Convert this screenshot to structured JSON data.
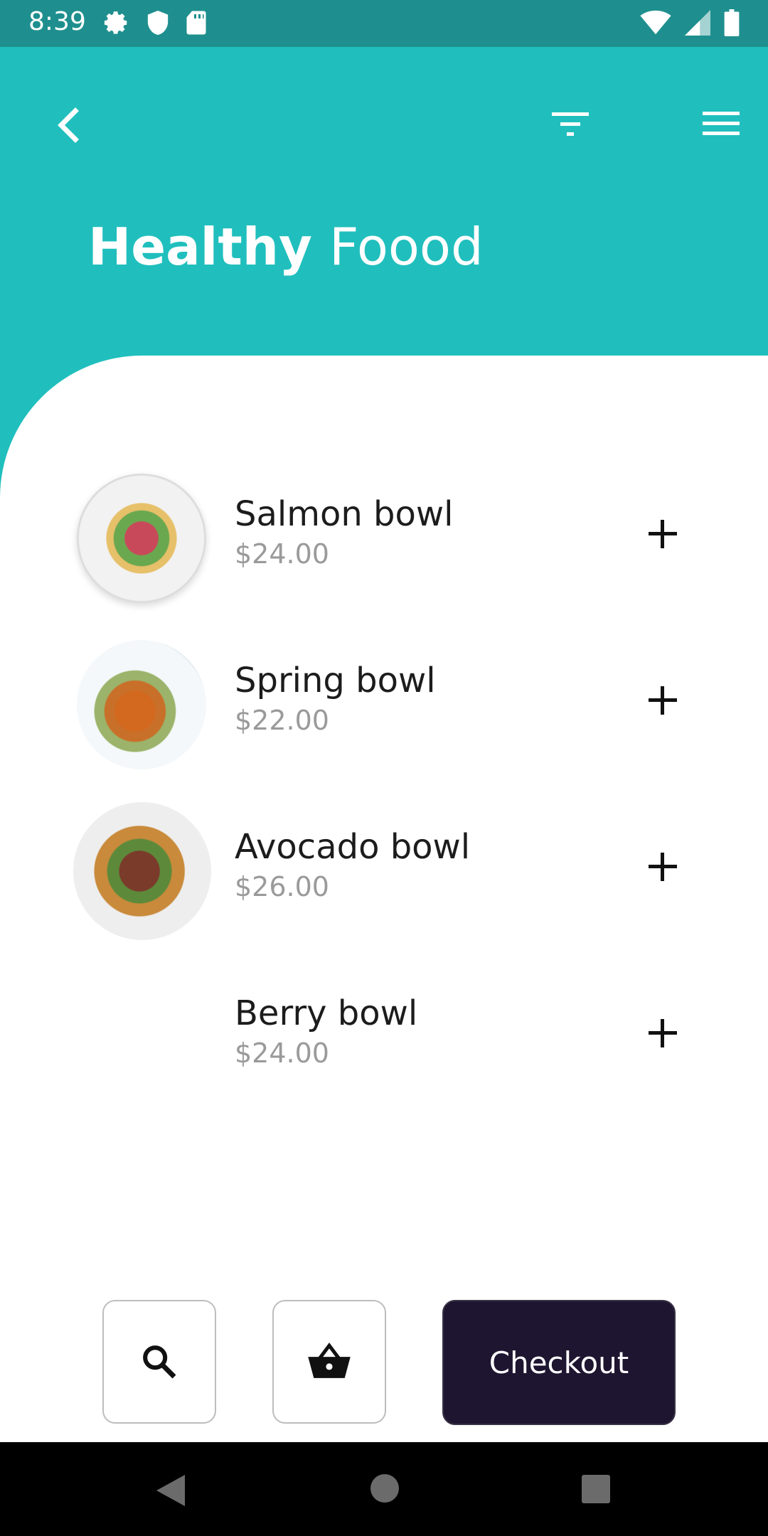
{
  "status_bar": {
    "time": "8:39",
    "icons_left": [
      "settings-icon",
      "shield-icon",
      "sd-card-icon"
    ],
    "icons_right": [
      "wifi-icon",
      "signal-icon",
      "battery-icon"
    ]
  },
  "header": {
    "title_bold": "Healthy",
    "title_light": "Foood",
    "background_color": "#20BFBD"
  },
  "items": [
    {
      "name": "Salmon bowl",
      "price": "$24.00",
      "image": "salmon-bowl"
    },
    {
      "name": "Spring bowl",
      "price": "$22.00",
      "image": "spring-bowl"
    },
    {
      "name": "Avocado bowl",
      "price": "$26.00",
      "image": "avocado-bowl"
    },
    {
      "name": "Berry bowl",
      "price": "$24.00",
      "image": null
    }
  ],
  "bottom_bar": {
    "checkout_label": "Checkout",
    "checkout_color": "#1E1530"
  }
}
